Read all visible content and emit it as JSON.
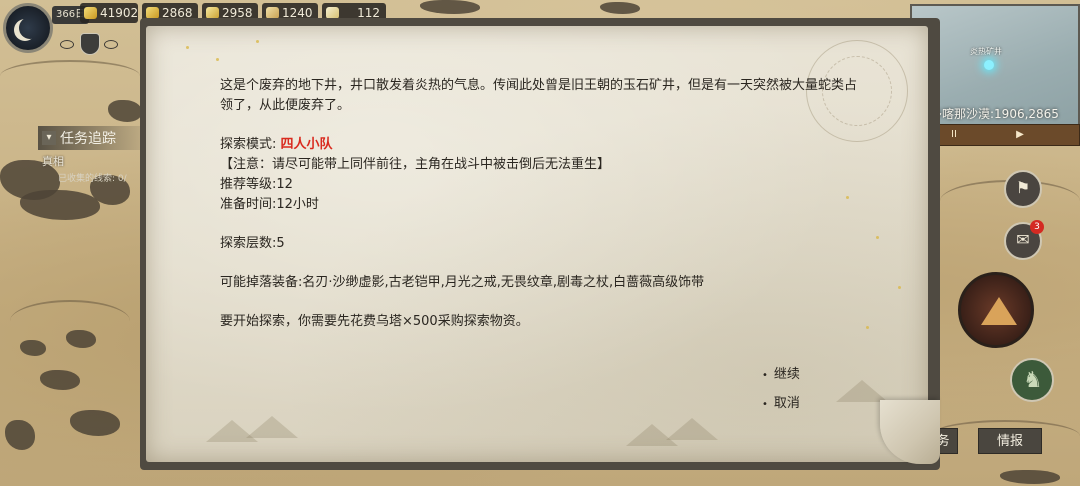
{
  "resources": {
    "day": "366日",
    "gold": "41902",
    "bars": "2868",
    "silver": "2958",
    "food": "1240",
    "horn": "112"
  },
  "tracker": {
    "title": "任务追踪",
    "item": "真相",
    "sub": "已收集的线索: 0/"
  },
  "minimap": {
    "label": "炎热矿井",
    "coord": "多喀那沙漠:1906,2865",
    "pause_label": "II",
    "play_label": "▶"
  },
  "side_buttons": {
    "notify_count": "3"
  },
  "bottom_buttons": {
    "task_label": "务",
    "intel_label": "情报"
  },
  "dialog": {
    "intro": "这是个废弃的地下井，井口散发着炎热的气息。传闻此处曾是旧王朝的玉石矿井，但是有一天突然被大量蛇类占领了，从此便废弃了。",
    "mode_label": "探索模式: ",
    "mode_value": "四人小队",
    "notice": "【注意：请尽可能带上同伴前往，主角在战斗中被击倒后无法重生】",
    "level": "推荐等级:12",
    "prep_time": "准备时间:12小时",
    "floors": "探索层数:5",
    "drops": "可能掉落装备:名刃·沙缈虚影,古老铠甲,月光之戒,无畏纹章,剧毒之杖,白蔷薇高级饰带",
    "cost": "要开始探索，你需要先花费乌塔×500采购探索物资。",
    "continue_label": "继续",
    "cancel_label": "取消"
  }
}
